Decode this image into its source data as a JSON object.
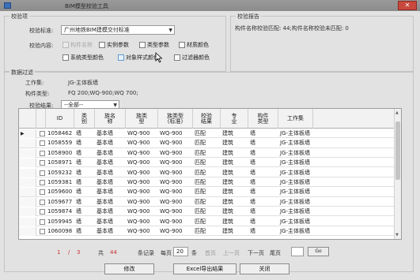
{
  "window": {
    "title": "BIM模型校验工具",
    "close_symbol": "✕"
  },
  "check_items": {
    "group_title": "校验项",
    "standard_label": "校验标准:",
    "standard_value": "广州地铁BIM建模交付标准",
    "content_label": "校验内容:",
    "options": [
      {
        "label": "构件名称",
        "checked": false,
        "enabled": false
      },
      {
        "label": "实例参数",
        "checked": false,
        "enabled": true
      },
      {
        "label": "类型参数",
        "checked": false,
        "enabled": true
      },
      {
        "label": "材质颜色",
        "checked": false,
        "enabled": true
      },
      {
        "label": "系统类型颜色",
        "checked": false,
        "enabled": true
      },
      {
        "label": "对象样式颜色",
        "checked": false,
        "enabled": true
      },
      {
        "label": "过滤器颜色",
        "checked": false,
        "enabled": true
      }
    ]
  },
  "report": {
    "group_title": "校验报告",
    "text": "构件名称校验匹配: 44;构件名称校验未匹配: 0"
  },
  "filter": {
    "group_title": "数据过滤",
    "workset_label": "工作集:",
    "workset_value": "JG-主体板墙",
    "type_label": "构件类型:",
    "type_value": "FQ 200;WQ-900;WQ 700;",
    "result_label": "校验结果:",
    "result_value": "--全部--"
  },
  "grid": {
    "columns": [
      "ID",
      "类\n别",
      "族名\n称",
      "族类\n型",
      "族类型\n(标准)",
      "校验\n结果",
      "专\n业",
      "构件\n类型",
      "工作集"
    ],
    "rows": [
      [
        "1058462",
        "墙",
        "基本墙",
        "WQ-900",
        "WQ-900",
        "匹配",
        "建筑",
        "墙",
        "JG-主体板墙"
      ],
      [
        "1058559",
        "墙",
        "基本墙",
        "WQ-900",
        "WQ-900",
        "匹配",
        "建筑",
        "墙",
        "JG-主体板墙"
      ],
      [
        "1058900",
        "墙",
        "基本墙",
        "WQ-900",
        "WQ-900",
        "匹配",
        "建筑",
        "墙",
        "JG-主体板墙"
      ],
      [
        "1058971",
        "墙",
        "基本墙",
        "WQ-900",
        "WQ-900",
        "匹配",
        "建筑",
        "墙",
        "JG-主体板墙"
      ],
      [
        "1059232",
        "墙",
        "基本墙",
        "WQ-900",
        "WQ-900",
        "匹配",
        "建筑",
        "墙",
        "JG-主体板墙"
      ],
      [
        "1059381",
        "墙",
        "基本墙",
        "WQ-900",
        "WQ-900",
        "匹配",
        "建筑",
        "墙",
        "JG-主体板墙"
      ],
      [
        "1059600",
        "墙",
        "基本墙",
        "WQ-900",
        "WQ-900",
        "匹配",
        "建筑",
        "墙",
        "JG-主体板墙"
      ],
      [
        "1059677",
        "墙",
        "基本墙",
        "WQ-900",
        "WQ-900",
        "匹配",
        "建筑",
        "墙",
        "JG-主体板墙"
      ],
      [
        "1059874",
        "墙",
        "基本墙",
        "WQ-900",
        "WQ-900",
        "匹配",
        "建筑",
        "墙",
        "JG-主体板墙"
      ],
      [
        "1059945",
        "墙",
        "基本墙",
        "WQ-900",
        "WQ-900",
        "匹配",
        "建筑",
        "墙",
        "JG-主体板墙"
      ],
      [
        "1060098",
        "墙",
        "基本墙",
        "WQ-900",
        "WQ-900",
        "匹配",
        "建筑",
        "墙",
        "JG-主体板墙"
      ]
    ]
  },
  "pager": {
    "current": "1",
    "slash": "/",
    "total_pages": "3",
    "total_label": "共",
    "total_records": "44",
    "records_label": "条记录",
    "per_page_label": "每页",
    "per_page": "20",
    "per_page_unit": "条",
    "first": "首页",
    "prev": "上一页",
    "next": "下一页",
    "last": "尾页",
    "goto_value": "",
    "go": "Go"
  },
  "actions": {
    "modify": "修改",
    "export": "Excel导出结果",
    "close": "关闭"
  },
  "colors": {
    "page_number": "#c83232",
    "check_highlight": "#5e9ad6"
  }
}
